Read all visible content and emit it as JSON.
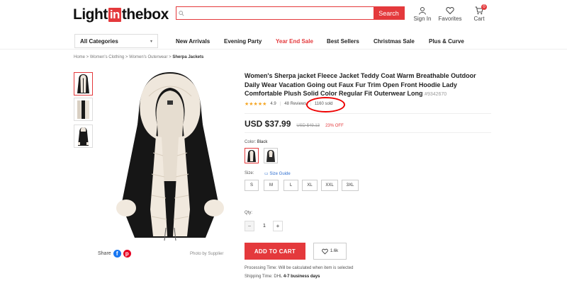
{
  "header": {
    "logo_left": "Light",
    "logo_in": "in",
    "logo_right": "thebox",
    "search_placeholder": "",
    "search_button": "Search",
    "signin_label": "Sign In",
    "favorites_label": "Favorites",
    "cart_label": "Cart",
    "cart_count": "0"
  },
  "nav": {
    "all_categories": "All Categories",
    "items": [
      "New Arrivals",
      "Evening Party",
      "Year End Sale",
      "Best Sellers",
      "Christmas Sale",
      "Plus & Curve"
    ]
  },
  "breadcrumb": {
    "home": "Home",
    "c1": "Women's Clothing",
    "c2": "Women's Outerwear",
    "current": "Sherpa Jackets",
    "sep": " > "
  },
  "product": {
    "title": "Women's Sherpa jacket Fleece Jacket Teddy Coat Warm Breathable Outdoor Daily Wear Vacation Going out Faux Fur Trim Open Front Hoodie Lady Comfortable Plush Solid Color Regular Fit Outerwear Long",
    "sku": "#9342670",
    "stars": "★★★★★",
    "rating": "4.9",
    "reviews": "48 Reviews",
    "sold": "1160 sold",
    "price": "USD $37.99",
    "old_price": "USD $49.13",
    "discount": "23% OFF",
    "color_label": "Color:",
    "color_value": "Black",
    "size_label": "Size:",
    "size_guide": "Size Guide",
    "sizes": [
      "S",
      "M",
      "L",
      "XL",
      "XXL",
      "3XL"
    ],
    "qty_label": "Qty:",
    "qty_minus": "−",
    "qty_value": "1",
    "qty_plus": "+",
    "add_to_cart": "ADD TO CART",
    "favorites_count": "1.6k",
    "processing_label": "Processing Time:",
    "processing_value": "Will be calculated when item is selected",
    "shipping_label": "Shipping Time:",
    "shipping_carrier": "DHL",
    "shipping_value": "4-7 business days"
  },
  "gallery": {
    "share_label": "Share",
    "photo_credit": "Photo by Supplier"
  },
  "colors": {
    "accent": "#e4393c",
    "facebook": "#1877f2",
    "pinterest": "#e60023",
    "annotation": "#ee0000"
  }
}
